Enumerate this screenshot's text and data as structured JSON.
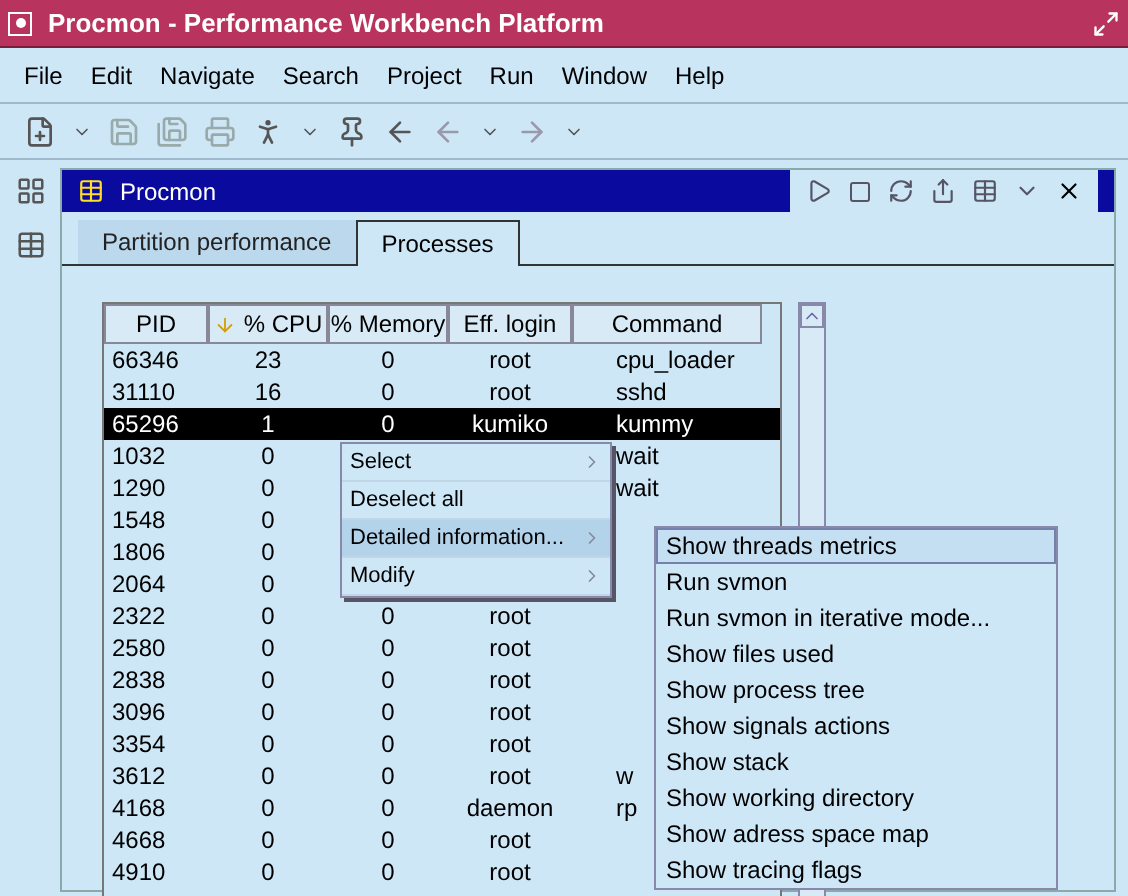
{
  "window": {
    "title": "Procmon - Performance Workbench Platform"
  },
  "menu": [
    "File",
    "Edit",
    "Navigate",
    "Search",
    "Project",
    "Run",
    "Window",
    "Help"
  ],
  "view": {
    "title": "Procmon",
    "tabs": [
      {
        "label": "Partition performance",
        "selected": false
      },
      {
        "label": "Processes",
        "selected": true
      }
    ],
    "table": {
      "columns": [
        "PID",
        "% CPU",
        "% Memory",
        "Eff. login",
        "Command"
      ],
      "rows": [
        {
          "cells": [
            "66346",
            "23",
            "0",
            "root",
            "cpu_loader"
          ],
          "selected": false
        },
        {
          "cells": [
            "31110",
            "16",
            "0",
            "root",
            "sshd"
          ],
          "selected": false
        },
        {
          "cells": [
            "65296",
            "1",
            "0",
            "kumiko",
            "kummy"
          ],
          "selected": true
        },
        {
          "cells": [
            "1032",
            "0",
            null,
            null,
            "wait"
          ],
          "selected": false
        },
        {
          "cells": [
            "1290",
            "0",
            null,
            null,
            "wait"
          ],
          "selected": false
        },
        {
          "cells": [
            "1548",
            "0",
            null,
            null,
            null
          ],
          "selected": false
        },
        {
          "cells": [
            "1806",
            "0",
            null,
            null,
            null
          ],
          "selected": false
        },
        {
          "cells": [
            "2064",
            "0",
            null,
            null,
            null
          ],
          "selected": false
        },
        {
          "cells": [
            "2322",
            "0",
            "0",
            "root",
            null
          ],
          "selected": false
        },
        {
          "cells": [
            "2580",
            "0",
            "0",
            "root",
            null
          ],
          "selected": false
        },
        {
          "cells": [
            "2838",
            "0",
            "0",
            "root",
            null
          ],
          "selected": false
        },
        {
          "cells": [
            "3096",
            "0",
            "0",
            "root",
            null
          ],
          "selected": false
        },
        {
          "cells": [
            "3354",
            "0",
            "0",
            "root",
            null
          ],
          "selected": false
        },
        {
          "cells": [
            "3612",
            "0",
            "0",
            "root",
            "w"
          ],
          "selected": false
        },
        {
          "cells": [
            "4168",
            "0",
            "0",
            "daemon",
            "rp"
          ],
          "selected": false
        },
        {
          "cells": [
            "4668",
            "0",
            "0",
            "root",
            null
          ],
          "selected": false
        },
        {
          "cells": [
            "4910",
            "0",
            "0",
            "root",
            null
          ],
          "selected": false
        }
      ]
    }
  },
  "context_menu": {
    "items": [
      {
        "label": "Select",
        "submenu": true,
        "selected": false
      },
      {
        "label": "Deselect all",
        "submenu": false,
        "selected": false
      },
      {
        "label": "Detailed information...",
        "submenu": true,
        "selected": true
      },
      {
        "label": "Modify",
        "submenu": true,
        "selected": false
      }
    ]
  },
  "submenu": {
    "items": [
      {
        "label": "Show threads metrics",
        "selected": true
      },
      {
        "label": "Run svmon",
        "selected": false
      },
      {
        "label": "Run svmon in iterative mode...",
        "selected": false
      },
      {
        "label": "Show files used",
        "selected": false
      },
      {
        "label": "Show process tree",
        "selected": false
      },
      {
        "label": "Show signals actions",
        "selected": false
      },
      {
        "label": "Show stack",
        "selected": false
      },
      {
        "label": "Show working directory",
        "selected": false
      },
      {
        "label": "Show adress space map",
        "selected": false
      },
      {
        "label": "Show tracing flags",
        "selected": false
      }
    ]
  }
}
